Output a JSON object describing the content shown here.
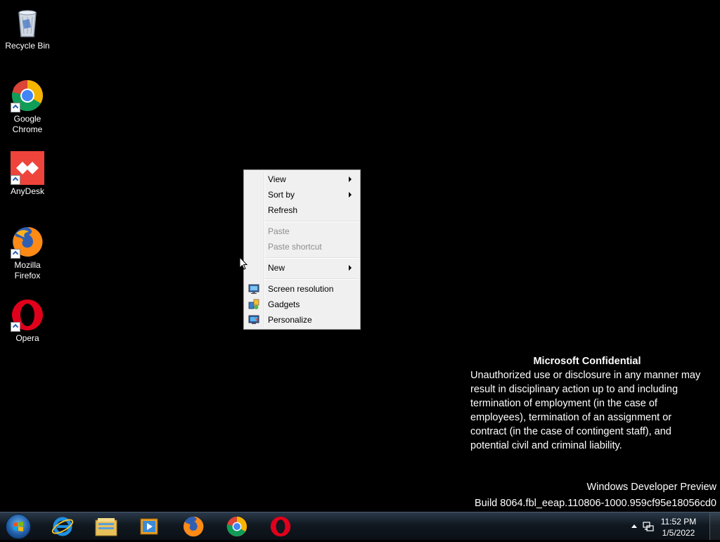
{
  "desktop_icons": [
    {
      "label": "Recycle Bin",
      "icon": "recycle-bin-icon"
    },
    {
      "label": "Google Chrome",
      "icon": "chrome-icon"
    },
    {
      "label": "AnyDesk",
      "icon": "anydesk-icon"
    },
    {
      "label": "Mozilla Firefox",
      "icon": "firefox-icon"
    },
    {
      "label": "Opera",
      "icon": "opera-icon"
    }
  ],
  "context_menu": {
    "view": "View",
    "sort_by": "Sort by",
    "refresh": "Refresh",
    "paste": "Paste",
    "paste_shortcut": "Paste shortcut",
    "new": "New",
    "screen_resolution": "Screen resolution",
    "gadgets": "Gadgets",
    "personalize": "Personalize"
  },
  "confidential": {
    "title": "Microsoft Confidential",
    "lines": [
      "Unauthorized use or disclosure in any manner may",
      "result in disciplinary action up to and including",
      "termination of employment (in the case of",
      "employees), termination of an assignment or",
      "contract (in the case of contingent staff), and",
      "potential civil and criminal liability."
    ]
  },
  "build": {
    "product": "Windows Developer Preview",
    "build_string": "Build 8064.fbl_eeap.110806-1000.959cf95e18056cd0"
  },
  "taskbar": {
    "pinned": [
      "internet-explorer-icon",
      "file-explorer-icon",
      "media-player-icon",
      "firefox-icon",
      "chrome-icon",
      "opera-icon"
    ],
    "time": "11:52 PM",
    "date": "1/5/2022"
  },
  "colors": {
    "desktop_bg": "#000000",
    "menu_bg": "#f0f0f0",
    "disabled_text": "#8d8d8d"
  }
}
